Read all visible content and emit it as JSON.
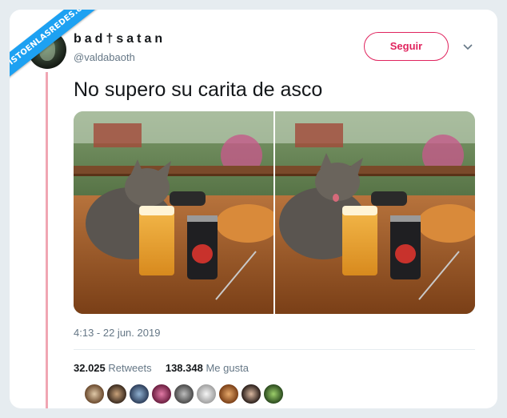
{
  "watermark": {
    "text": "VISTOENLASREDES.com"
  },
  "tweet": {
    "display_name": "bad†satan",
    "handle": "@valdabaoth",
    "follow_label": "Seguir",
    "text": "No supero su carita de asco",
    "timestamp": "4:13 - 22 jun. 2019",
    "retweets_count": "32.025",
    "retweets_label": "Retweets",
    "likes_count": "138.348",
    "likes_label": "Me gusta"
  },
  "media": {
    "photos": [
      {
        "name": "kitten-sniffing-beer"
      },
      {
        "name": "kitten-disgusted-face"
      }
    ]
  },
  "colors": {
    "accent": "#e0245e",
    "link": "#1da1f2",
    "thread_line": "#f0a6b3",
    "muted": "#657786"
  },
  "icons": [
    "chevron-down-icon"
  ]
}
